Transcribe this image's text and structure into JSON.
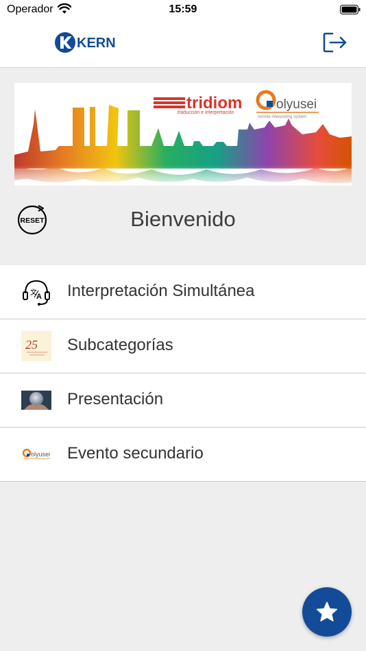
{
  "status_bar": {
    "carrier": "Operador",
    "time": "15:59"
  },
  "nav": {
    "brand": "KERN"
  },
  "banner": {
    "brand": "tridiom",
    "tagline": "traducción e interpretación",
    "partner": "olyusei",
    "partner_tagline": "remote interpreting system"
  },
  "reset_label": "RESET",
  "welcome": "Bienvenido",
  "menu": [
    {
      "label": "Interpretación Simultánea",
      "icon": "headset-translate-icon"
    },
    {
      "label": "Subcategorías",
      "icon": "anniversary-25-icon",
      "badge_text": "25"
    },
    {
      "label": "Presentación",
      "icon": "presentation-photo-icon"
    },
    {
      "label": "Evento secundario",
      "icon": "olyusei-logo-icon",
      "badge_text": "olyusei"
    }
  ],
  "colors": {
    "accent": "#134b98",
    "tridiom": "#d9342b",
    "olyusei_orange": "#e87a1d"
  }
}
